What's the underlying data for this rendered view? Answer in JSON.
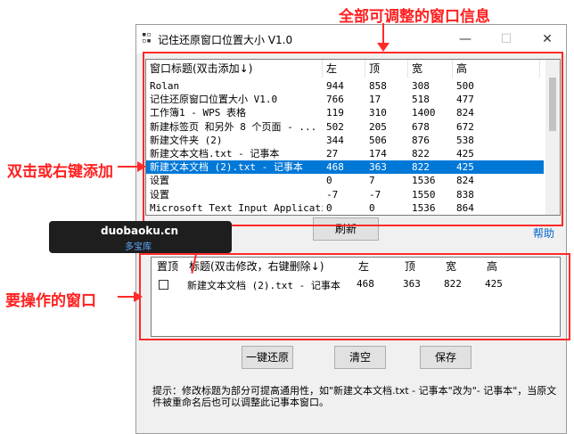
{
  "annotations": {
    "top": "全部可调整的窗口信息",
    "left_mid": "双击或右键添加",
    "left_bottom": "要操作的窗口"
  },
  "window": {
    "title": "记住还原窗口位置大小 V1.0",
    "icon": "app-icon",
    "buttons": {
      "minimize": "—",
      "maximize": "☐",
      "close": "✕"
    }
  },
  "top_list": {
    "columns": [
      "窗口标题(双击添加↓)",
      "左",
      "顶",
      "宽",
      "高"
    ],
    "rows": [
      [
        "Rolan",
        "944",
        "858",
        "308",
        "500"
      ],
      [
        "记住还原窗口位置大小 V1.0",
        "766",
        "17",
        "518",
        "477"
      ],
      [
        "工作簿1 - WPS 表格",
        "119",
        "310",
        "1400",
        "824"
      ],
      [
        "新建标签页 和另外 8 个页面 - ...",
        "502",
        "205",
        "678",
        "672"
      ],
      [
        "新建文件夹 (2)",
        "344",
        "506",
        "876",
        "538"
      ],
      [
        "新建文本文档.txt - 记事本",
        "27",
        "174",
        "822",
        "425"
      ],
      [
        "新建文本文档 (2).txt - 记事本",
        "468",
        "363",
        "822",
        "425"
      ],
      [
        "设置",
        "0",
        "7",
        "1536",
        "824"
      ],
      [
        "设置",
        "-7",
        "-7",
        "1550",
        "838"
      ],
      [
        "Microsoft Text Input Application",
        "0",
        "0",
        "1536",
        "864"
      ]
    ],
    "selected_index": 6
  },
  "refresh_label": "刷新",
  "help_label": "帮助",
  "bottom_list": {
    "columns": [
      "置顶",
      "标题(双击修改，右键删除↓)",
      "左",
      "顶",
      "宽",
      "高"
    ],
    "rows": [
      [
        "",
        "新建文本文档 (2).txt - 记事本",
        "468",
        "363",
        "822",
        "425"
      ]
    ]
  },
  "buttons": {
    "restore_all": "一键还原",
    "clear": "清空",
    "save": "保存"
  },
  "hint": "提示：修改标题为部分可提高通用性，如\"新建文本文档.txt - 记事本\"改为\"- 记事本\"，当原文件被重命名后也可以调整此记事本窗口。",
  "watermark": {
    "line1": "duobaoku.cn",
    "line2": "多宝库"
  },
  "colors": {
    "annotation_red": "#ff2a2a",
    "selection_blue": "#0078d7",
    "link_blue": "#0066cc"
  }
}
